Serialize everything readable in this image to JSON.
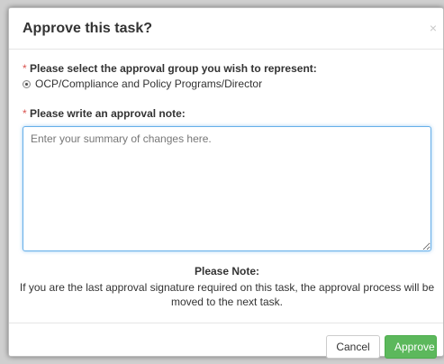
{
  "dialog": {
    "title": "Approve this task?",
    "close_symbol": "×",
    "close_icon": "close-icon"
  },
  "group": {
    "required_mark": "*",
    "label": "Please select the approval group you wish to represent:",
    "option": "OCP/Compliance and Policy Programs/Director",
    "selected": true
  },
  "note": {
    "required_mark": "*",
    "label": "Please write an approval note:",
    "placeholder": "Enter your summary of changes here.",
    "value": ""
  },
  "notice": {
    "title": "Please Note:",
    "text": "If you are the last approval signature required on this task, the approval process will be moved to the next task."
  },
  "footer": {
    "cancel_label": "Cancel",
    "approve_label": "Approve"
  },
  "colors": {
    "required": "#d9534f",
    "approve_bg": "#5cb85c",
    "focus_border": "#66afe9"
  }
}
